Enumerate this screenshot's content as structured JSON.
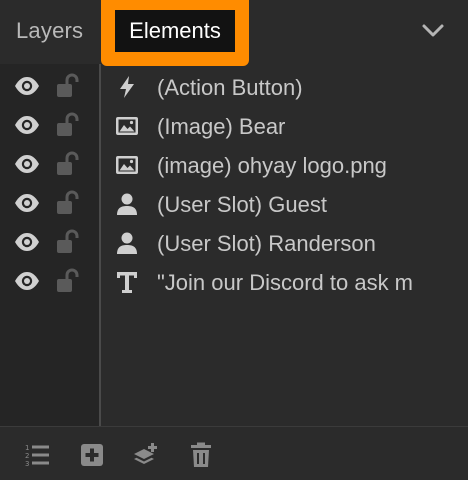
{
  "tabs": {
    "layers_label": "Layers",
    "elements_label": "Elements"
  },
  "highlight_color": "#ff8c00",
  "header_icons": [
    "chevron-down-icon"
  ],
  "elements": [
    {
      "label": "(Action Button)",
      "icon": "lightning-icon"
    },
    {
      "label": "(Image) Bear",
      "icon": "image-icon"
    },
    {
      "label": "(image) ohyay logo.png",
      "icon": "image-icon"
    },
    {
      "label": "(User Slot) Guest",
      "icon": "user-icon"
    },
    {
      "label": "(User Slot) Randerson",
      "icon": "user-icon"
    },
    {
      "label": "\"Join our Discord to ask m",
      "icon": "text-icon"
    }
  ],
  "row_controls": [
    "eye-icon",
    "unlock-icon"
  ],
  "footer_icons": [
    "numbered-list-icon",
    "add-icon",
    "add-layer-icon",
    "trash-icon"
  ]
}
